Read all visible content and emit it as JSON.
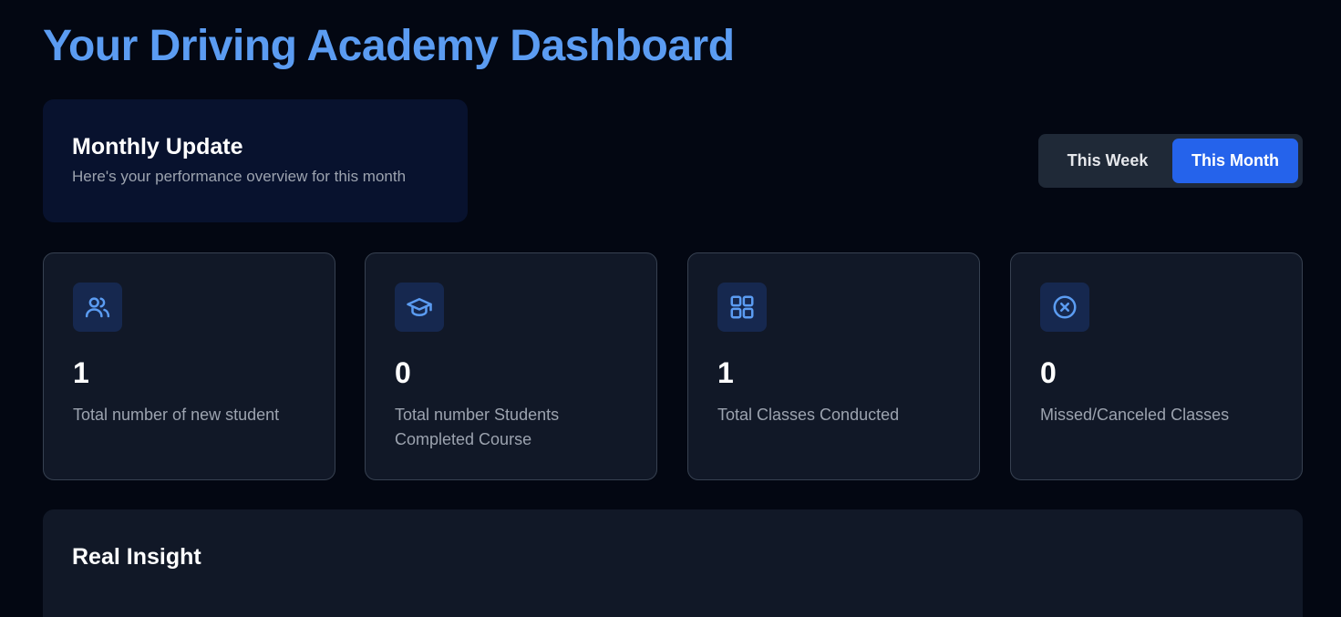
{
  "page_title": "Your Driving Academy Dashboard",
  "monthly_update": {
    "title": "Monthly Update",
    "subtitle": "Here's your performance overview for this month"
  },
  "period_toggle": {
    "options": [
      {
        "label": "This Week",
        "selected": false
      },
      {
        "label": "This Month",
        "selected": true
      }
    ]
  },
  "stats": [
    {
      "icon": "users-icon",
      "value": "1",
      "label": "Total number of new student"
    },
    {
      "icon": "graduation-cap-icon",
      "value": "0",
      "label": "Total number Students Completed Course"
    },
    {
      "icon": "grid-icon",
      "value": "1",
      "label": "Total Classes Conducted"
    },
    {
      "icon": "x-circle-icon",
      "value": "0",
      "label": "Missed/Canceled Classes"
    }
  ],
  "insight": {
    "title": "Real Insight"
  },
  "colors": {
    "background": "#030712",
    "accent": "#2563eb",
    "title": "#5b9cf2",
    "card": "#111827",
    "highlight_card": "#08122e"
  }
}
